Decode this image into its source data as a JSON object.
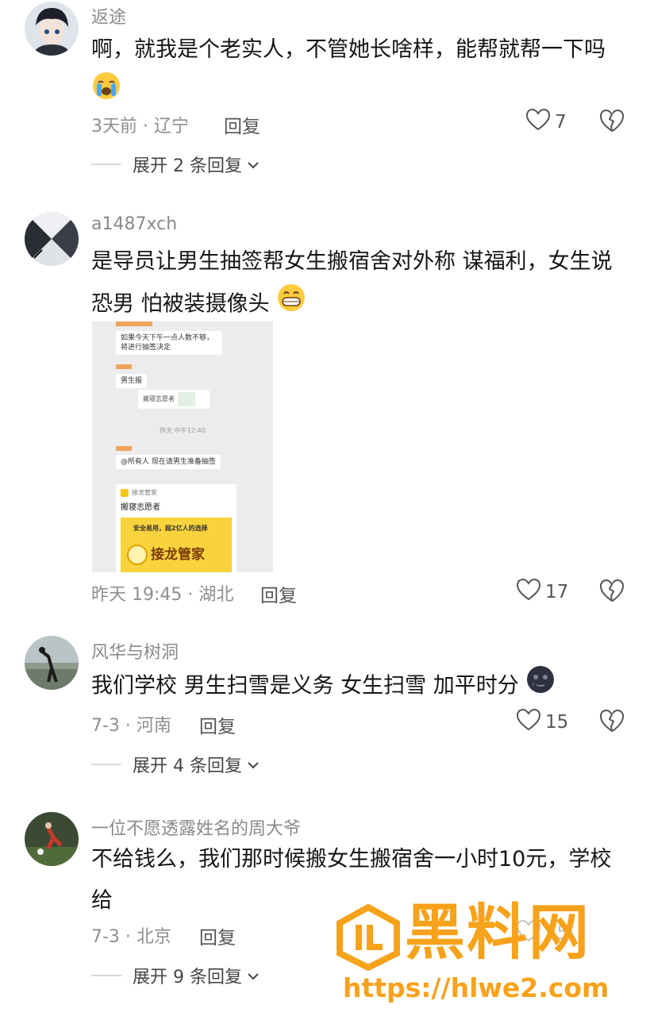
{
  "comments": [
    {
      "username": "返途",
      "text": "啊，就我是个老实人，不管她长啥样，能帮就帮一下吗",
      "emoji": "crying-face",
      "time": "3天前 · 辽宁",
      "reply_label": "回复",
      "likes": "7",
      "expand": "展开 2 条回复"
    },
    {
      "username": "a1487xch",
      "text": "是导员让男生抽签帮女生搬宿舍对外称 谋福利，女生说恐男 怕被装摄像头",
      "emoji": "grinning-face",
      "time": "昨天 19:45 · 湖北",
      "reply_label": "回复",
      "likes": "17",
      "image": {
        "msg1": "如果今天下午一点人数不够，将进行抽签决定",
        "msg2": "男生报",
        "share": "搬寝志愿者",
        "timestamp": "昨天 中午12:40",
        "msg3": "@所有人  现在请男生准备抽签",
        "card_app": "接龙管家",
        "card_title": "搬寝志愿者",
        "banner_line": "安全易用，超2亿人的选择",
        "banner_brand": "接龙管家"
      }
    },
    {
      "username": "风华与树洞",
      "text": "我们学校 男生扫雪是义务 女生扫雪 加平时分",
      "emoji": "new-moon-face",
      "time": "7-3 · 河南",
      "reply_label": "回复",
      "likes": "15",
      "expand": "展开 4 条回复"
    },
    {
      "username": "一位不愿透露姓名的周大爷",
      "text": "不给钱么，我们那时候搬女生搬宿舍一小时10元，学校给",
      "time": "7-3 · 北京",
      "reply_label": "回复",
      "likes": "25",
      "expand": "展开 9 条回复"
    }
  ],
  "watermark": {
    "brand": "黑料网",
    "url": "https://hlwe2.com",
    "color": "#f7a21b"
  }
}
